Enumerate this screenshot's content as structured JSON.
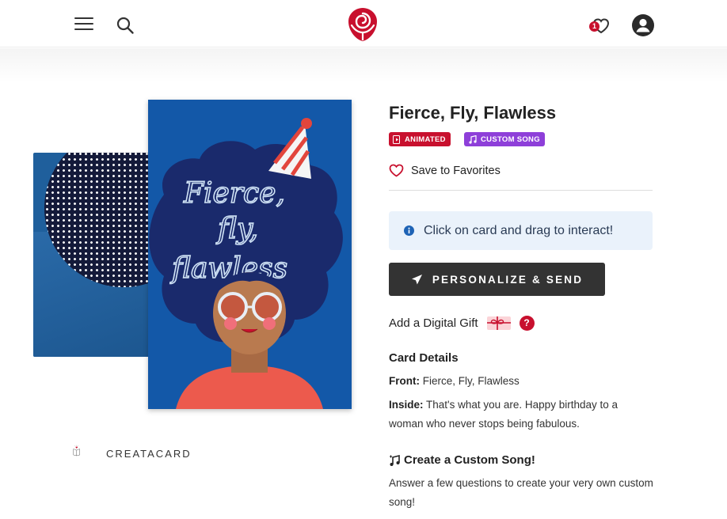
{
  "header": {
    "menu_icon": "hamburger-menu-icon",
    "search_icon": "search-icon",
    "logo_icon": "rose-logo-icon",
    "favorites_icon": "heart-icon",
    "favorites_count": "1",
    "account_icon": "user-icon"
  },
  "brand": {
    "creatacard_label": "CREATACARD",
    "accent": "#c8102e"
  },
  "product": {
    "title": "Fierce, Fly, Flawless",
    "badges": [
      {
        "label": "ANIMATED",
        "color": "#c8102e",
        "icon": "animated-icon"
      },
      {
        "label": "CUSTOM SONG",
        "color": "#8e3fd9",
        "icon": "music-note-icon"
      }
    ],
    "save_label": "Save to Favorites",
    "info_text": "Click on card and drag to interact!",
    "cta_label": "PERSONALIZE & SEND",
    "gift_label": "Add a Digital Gift",
    "details_heading": "Card Details",
    "front_label": "Front:",
    "front_text": "Fierce, Fly, Flawless",
    "inside_label": "Inside:",
    "inside_text": "That's what you are. Happy birthday to a woman who never stops being fabulous.",
    "song_heading": "Create a Custom Song!",
    "song_text": "Answer a few questions to create your very own custom song!"
  }
}
